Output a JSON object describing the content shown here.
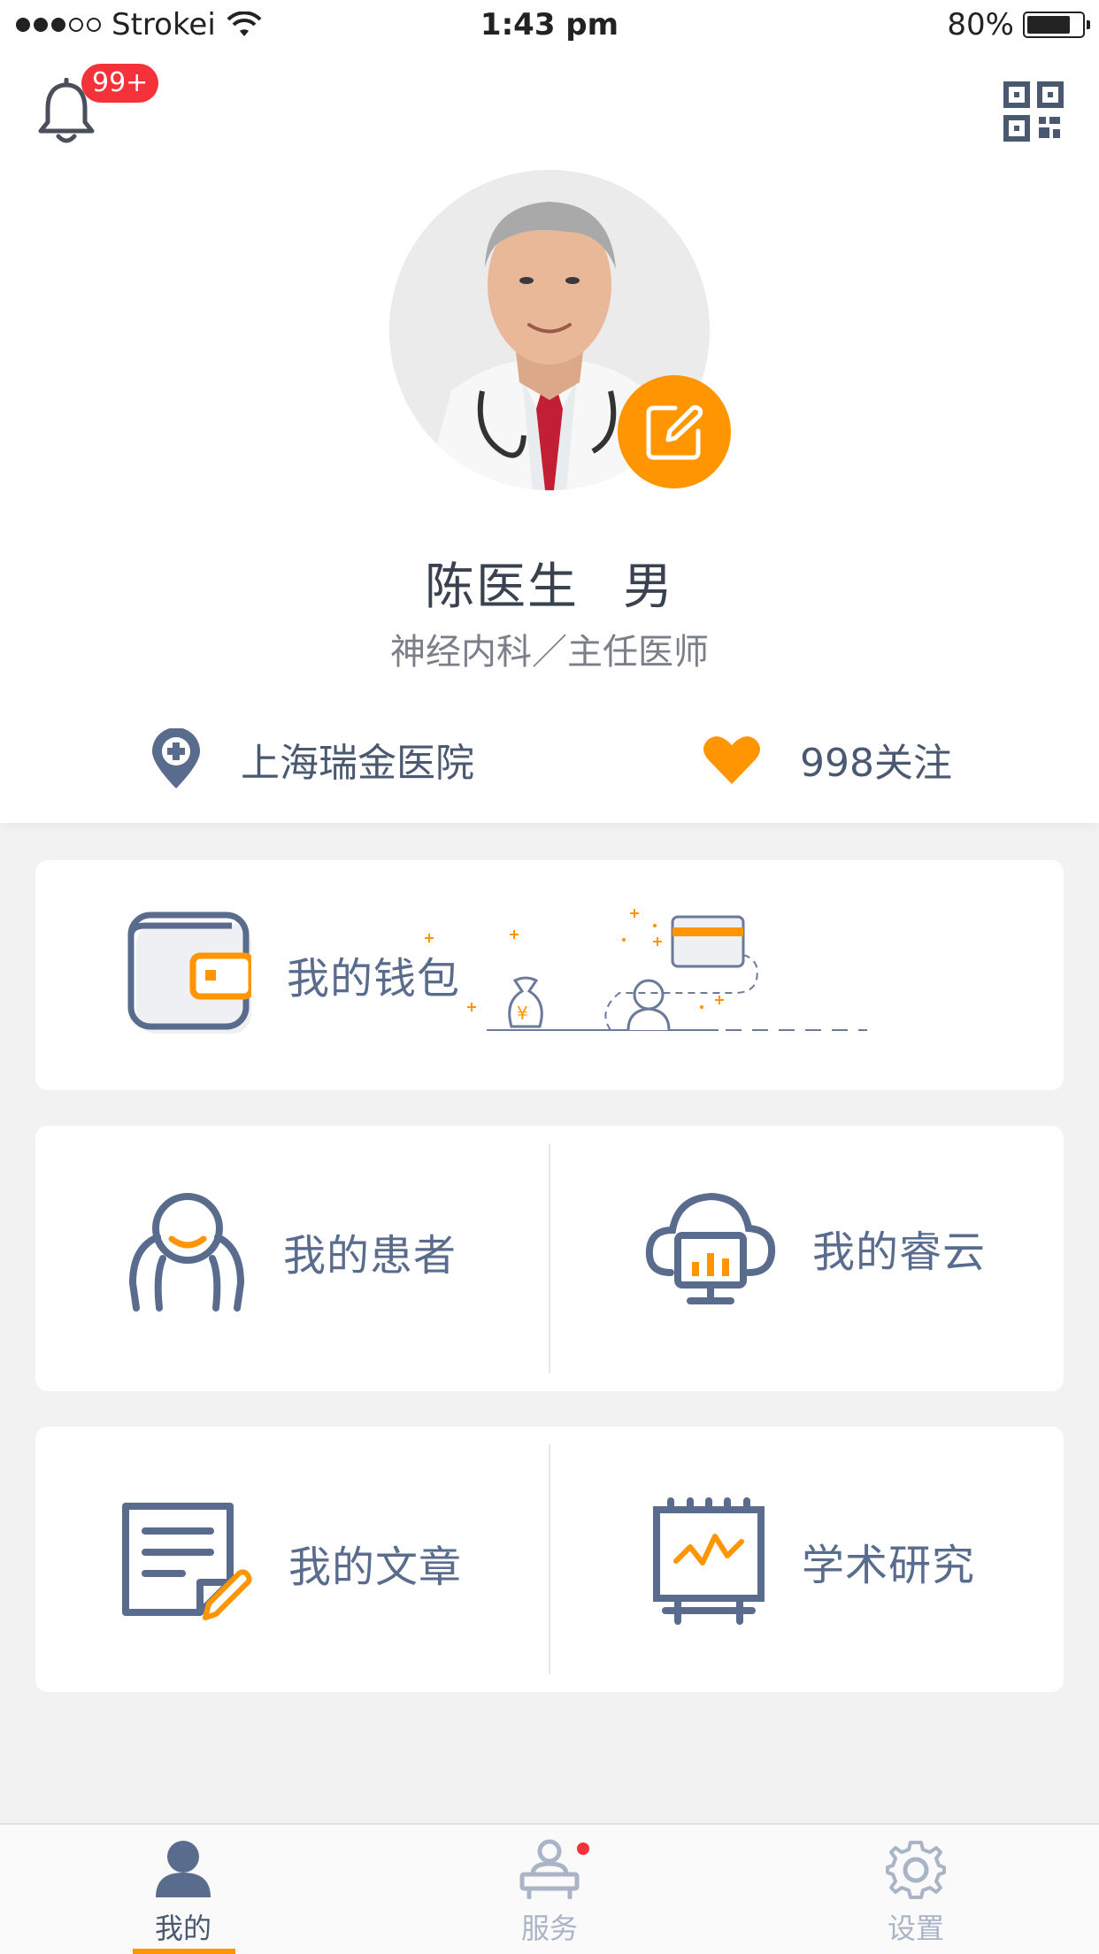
{
  "status_bar": {
    "carrier": "Strokei",
    "time": "1:43 pm",
    "battery": "80%",
    "battery_level": 0.8,
    "signal_bars_filled": 3,
    "signal_bars_total": 5
  },
  "header": {
    "notification_badge": "99+",
    "bell_icon": "bell-icon",
    "qr_icon": "qr-code-icon"
  },
  "profile": {
    "name": "陈医生",
    "gender": "男",
    "department_title": "神经内科／主任医师",
    "hospital": "上海瑞金医院",
    "follow_count": "998关注",
    "edit_icon": "edit-pencil-icon"
  },
  "menu": {
    "wallet": "我的钱包",
    "patients": "我的患者",
    "cloud": "我的睿云",
    "articles": "我的文章",
    "research": "学术研究"
  },
  "tabbar": {
    "tabs": [
      {
        "label": "我的",
        "icon": "person-icon",
        "active": true
      },
      {
        "label": "服务",
        "icon": "service-desk-icon",
        "active": false,
        "has_dot": true
      },
      {
        "label": "设置",
        "icon": "gear-icon",
        "active": false
      }
    ]
  },
  "colors": {
    "accent": "#ff9500",
    "icon_blue": "#5a6c8e",
    "badge_red": "#f5323a"
  }
}
